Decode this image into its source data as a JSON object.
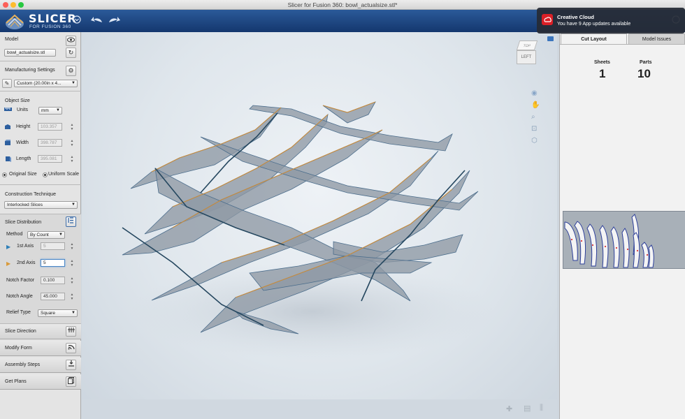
{
  "window": {
    "title": "Slicer for Fusion 360: bowl_actualsize.stl*"
  },
  "app": {
    "logo_title": "SLICER",
    "logo_subtitle": "FOR FUSION 360"
  },
  "notification": {
    "title": "Creative Cloud",
    "message": "You have 9 App updates available"
  },
  "model": {
    "label": "Model",
    "file": "bowl_actualsize.stl"
  },
  "manufacturing": {
    "label": "Manufacturing Settings",
    "value": "Custom (20.00in x 4..."
  },
  "object_size": {
    "label": "Object Size",
    "units_label": "Units",
    "units_value": "mm",
    "height_label": "Height",
    "height_value": "103.357",
    "width_label": "Width",
    "width_value": "398.787",
    "length_label": "Length",
    "length_value": "395.081",
    "original_label": "Original Size",
    "uniform_label": "Uniform Scale"
  },
  "construction": {
    "label": "Construction Technique",
    "value": "Interlocked Slices"
  },
  "slice_distribution": {
    "label": "Slice Distribution",
    "method_label": "Method",
    "method_value": "By Count",
    "axis1_label": "1st Axis",
    "axis1_value": "5",
    "axis2_label": "2nd Axis",
    "axis2_value": "5",
    "notch_factor_label": "Notch Factor",
    "notch_factor_value": "0.100",
    "notch_angle_label": "Notch Angle",
    "notch_angle_value": "45.000",
    "relief_label": "Relief Type",
    "relief_value": "Square"
  },
  "nav": {
    "slice_direction": "Slice Direction",
    "modify_form": "Modify Form",
    "assembly_steps": "Assembly Steps",
    "get_plans": "Get Plans"
  },
  "viewcube": {
    "face": "LEFT",
    "top": "TOP"
  },
  "right_panel": {
    "tabs": [
      "Cut Layout",
      "Model Issues"
    ],
    "sheets_label": "Sheets",
    "sheets_value": "1",
    "parts_label": "Parts",
    "parts_value": "10"
  },
  "colors": {
    "appbar": "#1d4682",
    "accent": "#2d5f9f",
    "slice_fill": "#8e98a4",
    "slice_edge": "#c78a3a"
  },
  "icons": [
    "eye-icon",
    "refresh-icon",
    "gear-icon",
    "pencil-icon",
    "ruler-icon",
    "height-icon",
    "width-icon",
    "length-icon",
    "distribution-icon",
    "grid-icon",
    "wifi-form-icon",
    "assembly-icon",
    "plans-icon",
    "pan-icon",
    "zoom-icon",
    "fit-icon",
    "orbit-icon",
    "home-icon"
  ]
}
